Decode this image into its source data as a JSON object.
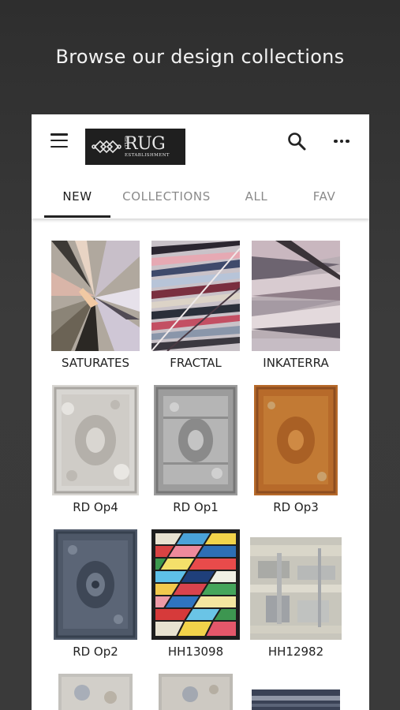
{
  "promo": {
    "title": "Browse our design collections"
  },
  "app_bar": {
    "logo_main": "RUG",
    "logo_the": "THE",
    "logo_sub": "ESTABLISHMENT",
    "search_icon": "search-icon",
    "menu_icon": "hamburger-menu-icon",
    "more_icon": "more-horizontal-icon"
  },
  "tabs": [
    {
      "label": "NEW",
      "active": true
    },
    {
      "label": "COLLECTIONS",
      "active": false
    },
    {
      "label": "ALL",
      "active": false
    },
    {
      "label": "FAV",
      "active": false
    }
  ],
  "rugs": [
    {
      "label": "SATURATES"
    },
    {
      "label": "FRACTAL"
    },
    {
      "label": "INKATERRA"
    },
    {
      "label": "RD Op4"
    },
    {
      "label": "RD Op1"
    },
    {
      "label": "RD Op3"
    },
    {
      "label": "RD Op2"
    },
    {
      "label": "HH13098"
    },
    {
      "label": "HH12982"
    }
  ]
}
